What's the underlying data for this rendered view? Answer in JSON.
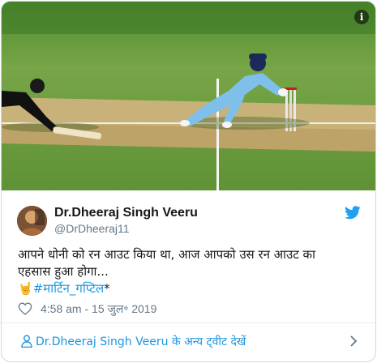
{
  "tweet": {
    "author_name": "Dr.Dheeraj Singh Veeru",
    "author_handle": "@DrDheeraj11",
    "text_line_1": "आपने धोनी को रन आउट किया था, आज आपको उस रन आउट का",
    "text_line_2": "एहसास हुआ होगा...",
    "hand_emoji": "🤘",
    "hashtag": "#मार्टिन_गप्टिल",
    "trailing": "*",
    "timestamp": "4:58 am - 15 जुल॰ 2019",
    "info_label": "i"
  },
  "footer": {
    "link_text": "Dr.Dheeraj Singh Veeru के अन्य ट्वीट देखें"
  },
  "icons": {
    "bird": "twitter-bird-icon",
    "heart": "heart-icon",
    "person": "person-icon",
    "chevron": "chevron-right-icon"
  },
  "colors": {
    "link": "#1b95e0",
    "muted": "#657786",
    "text": "#14171a"
  }
}
